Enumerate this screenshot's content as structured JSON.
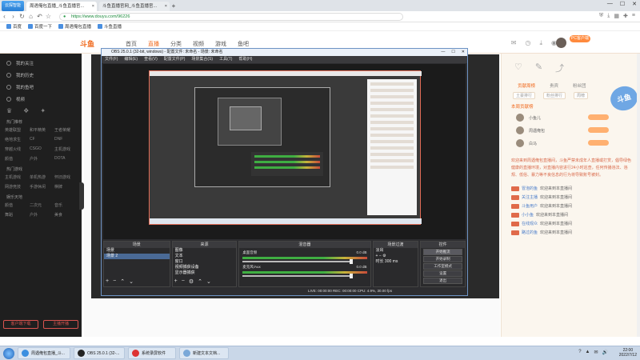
{
  "browser": {
    "logo_label": "云探智能",
    "tabs": [
      {
        "title": "周遇俺包直播_斗鱼直播官...",
        "active": true
      },
      {
        "title": "斗鱼直播官网_斗鱼直播官...",
        "active": false
      }
    ],
    "url": "https://www.douyu.com/96226",
    "bookmarks": [
      "百度",
      "百度一下",
      "周遇俺包直播",
      "斗鱼直播"
    ]
  },
  "site": {
    "logo_text": "斗鱼",
    "nav": [
      "首页",
      "直播",
      "分类",
      "视频",
      "游戏",
      "鱼吧"
    ],
    "active_nav": 1,
    "badge": "PC客户端"
  },
  "sidebar": {
    "items": [
      "我的关注",
      "我的历史",
      "我的鱼吧",
      "视频"
    ],
    "section1": "热门推荐",
    "grid1": [
      "英雄联盟",
      "和平精英",
      "王者荣耀",
      "绝地求生",
      "CF",
      "DNF",
      "穿越火线",
      "CSGO",
      "主机游戏",
      "颜值",
      "户外",
      "DOTA"
    ],
    "section2": "热门游戏",
    "grid2": [
      "主机游戏",
      "单机热游",
      "怀旧游戏",
      "网游竞技",
      "手游休闲",
      "棋牌"
    ],
    "section3": "娱乐天地",
    "grid3": [
      "颜值",
      "二次元",
      "音乐",
      "舞蹈",
      "户外",
      "美食"
    ],
    "bottom": [
      "客户端下载",
      "主播开播"
    ]
  },
  "obs": {
    "title": "OBS 25.0.1 (32-bit, windows) - 配置文件: 未命名 - 场景: 未命名",
    "menu": [
      "文件(F)",
      "编辑(E)",
      "查看(V)",
      "配置文件(P)",
      "场景集合(S)",
      "工具(T)",
      "帮助(H)"
    ],
    "docks": {
      "scenes": {
        "title": "场景",
        "items": [
          "场景",
          "场景 2"
        ],
        "selected": 1
      },
      "sources": {
        "title": "来源",
        "items": [
          "图像",
          "文本",
          "窗口",
          "视频捕获设备",
          "显示器捕获"
        ]
      },
      "mixer": {
        "title": "混音器",
        "tracks": [
          "桌面音频",
          "麦克风/Aux"
        ],
        "levels": [
          "0.0 dB",
          "0.0 dB"
        ]
      },
      "transitions": {
        "title": "场景过渡",
        "type": "淡出",
        "duration_label": "时长",
        "duration": "300 ms"
      },
      "controls": {
        "title": "控件",
        "buttons": [
          "开始推流",
          "开始录制",
          "工作室模式",
          "设置",
          "退出"
        ]
      }
    },
    "status": "LIVE: 00:00:00    REC: 00:00:00    CPU: 4.9%, 30.00 fps"
  },
  "right_panel": {
    "tabs": [
      "贡献周榜",
      "贵宾",
      "粉丝团"
    ],
    "sub_tabs": [
      "土豪排行",
      "粉丝排行",
      "周榜"
    ],
    "rank_title": "本周贡献榜",
    "users": [
      "小鱼儿",
      "周遇俺包",
      "白马"
    ],
    "mascot": "斗鱼",
    "notice": "欢迎来到周遇俺包直播间，斗鱼严禁未成年人直播或打赏，倡导绿色健康的直播环境，对直播内容进行24小时巡查，任何传播违法、违规、低俗、暴力等不良信息的行为将导致账号被封。",
    "messages": [
      {
        "name": "冒泡的鱼",
        "text": "欢迎来到本直播间"
      },
      {
        "name": "关注主播",
        "text": "欢迎来到本直播间"
      },
      {
        "name": "斗鱼用户",
        "text": "欢迎来到本直播间"
      },
      {
        "name": "小小鱼",
        "text": "欢迎来到本直播间"
      },
      {
        "name": "在线观众",
        "text": "欢迎来到本直播间"
      },
      {
        "name": "路过的鱼",
        "text": "欢迎来到本直播间"
      }
    ]
  },
  "taskbar": {
    "apps": [
      "周遇俺包直播_斗...",
      "OBS 25.0.1 (32-...",
      "系统录屏软件",
      "新建文本文档..."
    ],
    "tray": [
      "?",
      "▲",
      "✉",
      "🔊"
    ],
    "time": "22:00",
    "date": "2022/7/12"
  }
}
